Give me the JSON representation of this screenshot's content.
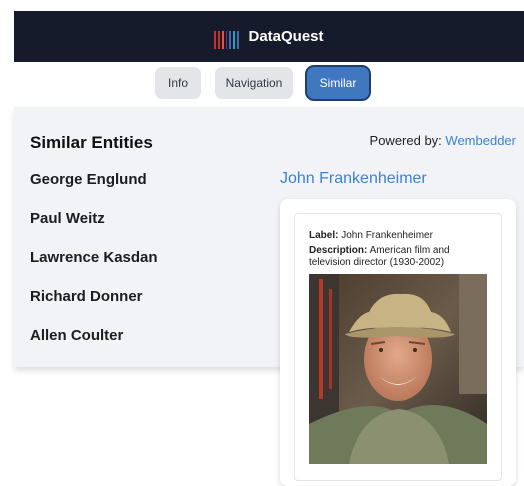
{
  "app": {
    "brand_name": "DataQuest",
    "accent_color": "#3f78bf",
    "link_color": "#3b82d6"
  },
  "tabs": [
    {
      "label": "Info",
      "active": false
    },
    {
      "label": "Navigation",
      "active": false
    },
    {
      "label": "Similar",
      "active": true
    }
  ],
  "similar": {
    "title": "Similar Entities",
    "powered_prefix": "Powered by:",
    "powered_link": "Wembedder",
    "entities": [
      "George Englund",
      "Paul Weitz",
      "Lawrence Kasdan",
      "Richard Donner",
      "Allen Coulter"
    ],
    "selected": "John Frankenheimer"
  },
  "card": {
    "label_key": "Label:",
    "label_value": "John Frankenheimer",
    "description_key": "Description:",
    "description_value": "American film and television director (1930-2002)"
  }
}
